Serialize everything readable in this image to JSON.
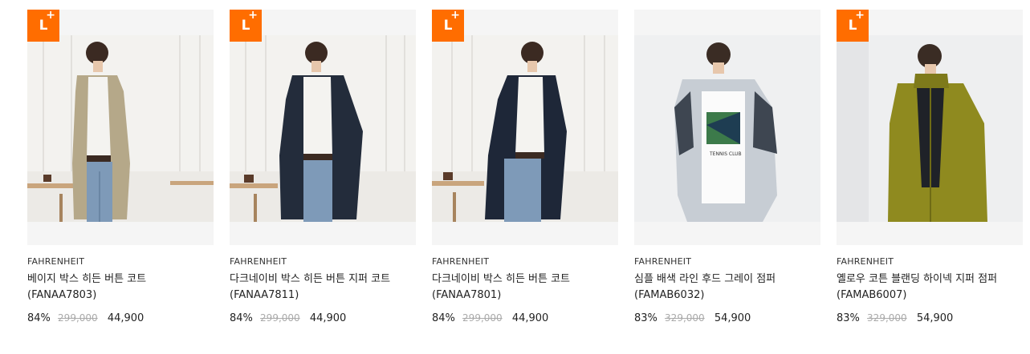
{
  "badge": {
    "letter": "L",
    "plus": "+"
  },
  "products": [
    {
      "brand": "FAHRENHEIT",
      "name": "베이지 박스 히든 버튼 코트 (FANAA7803)",
      "discount": "84%",
      "original_price": "299,000",
      "sale_price": "44,900",
      "has_badge": true,
      "coat_color": "#b5a889",
      "photo": "man in beige coat, white sweater, jeans, indoor room"
    },
    {
      "brand": "FAHRENHEIT",
      "name": "다크네이비 박스 히든 버튼 지퍼 코트 (FANAA7811)",
      "discount": "84%",
      "original_price": "299,000",
      "sale_price": "44,900",
      "has_badge": true,
      "coat_color": "#232c3b",
      "photo": "man in dark navy coat, white sweater, jeans"
    },
    {
      "brand": "FAHRENHEIT",
      "name": "다크네이비 박스 히든 버튼 코트 (FANAA7801)",
      "discount": "84%",
      "original_price": "299,000",
      "sale_price": "44,900",
      "has_badge": true,
      "coat_color": "#1e2738",
      "photo": "man in dark navy coat, white sweater, jeans"
    },
    {
      "brand": "FAHRENHEIT",
      "name": "심플 배색 라인 후드 그레이 점퍼 (FAMAB6032)",
      "discount": "83%",
      "original_price": "329,000",
      "sale_price": "54,900",
      "has_badge": false,
      "coat_color": "#c7cdd4",
      "photo": "man in light gray hooded jumper, graphic tee"
    },
    {
      "brand": "FAHRENHEIT",
      "name": "옐로우 코튼 블랜딩 하이넥 지퍼 점퍼 (FAMAB6007)",
      "discount": "83%",
      "original_price": "329,000",
      "sale_price": "54,900",
      "has_badge": true,
      "coat_color": "#8f8a1f",
      "photo": "man in yellow-olive high-neck zip jumper"
    }
  ]
}
